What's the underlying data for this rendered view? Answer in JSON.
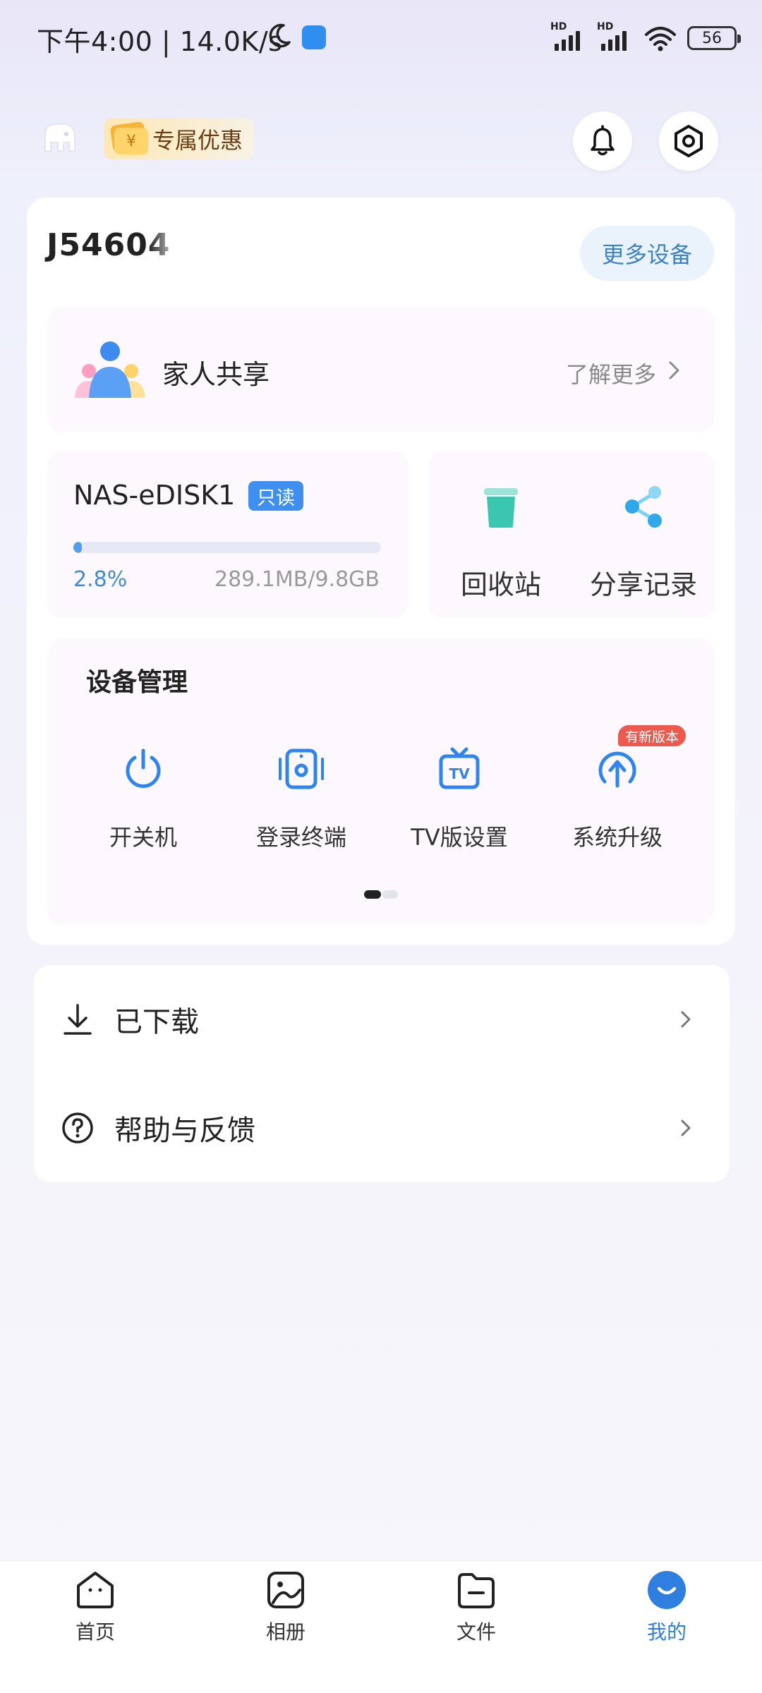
{
  "status_bar": {
    "time_speed": "下午4:00 | 14.0K/s",
    "battery": "56",
    "signal_labels": [
      "HD",
      "HD"
    ]
  },
  "header": {
    "promo_label": "专属优惠",
    "promo_coin_symbol": "¥"
  },
  "device": {
    "name": "J54604",
    "more_devices": "更多设备"
  },
  "family_share": {
    "title": "家人共享",
    "more": "了解更多"
  },
  "disk": {
    "name": "NAS-eDISK1",
    "badge": "只读",
    "usage_percent_text": "2.8%",
    "usage_fraction": 0.028,
    "size_text": "289.1MB/9.8GB"
  },
  "tools": {
    "recycle": "回收站",
    "share_records": "分享记录"
  },
  "device_management": {
    "title": "设备管理",
    "items": [
      {
        "label": "开关机",
        "icon": "power-icon"
      },
      {
        "label": "登录终端",
        "icon": "terminal-icon"
      },
      {
        "label": "TV版设置",
        "icon": "tv-icon"
      },
      {
        "label": "系统升级",
        "icon": "upgrade-icon"
      }
    ],
    "new_version_badge": "有新版本",
    "tv_icon_text": "TV"
  },
  "list": {
    "downloaded": "已下载",
    "help_feedback": "帮助与反馈"
  },
  "bottom_nav": {
    "home": "首页",
    "album": "相册",
    "files": "文件",
    "mine": "我的"
  },
  "colors": {
    "accent": "#2f7fe0",
    "badge_blue": "#3f8ff0",
    "badge_red": "#ec5a4e",
    "teal": "#3bc6b0"
  }
}
